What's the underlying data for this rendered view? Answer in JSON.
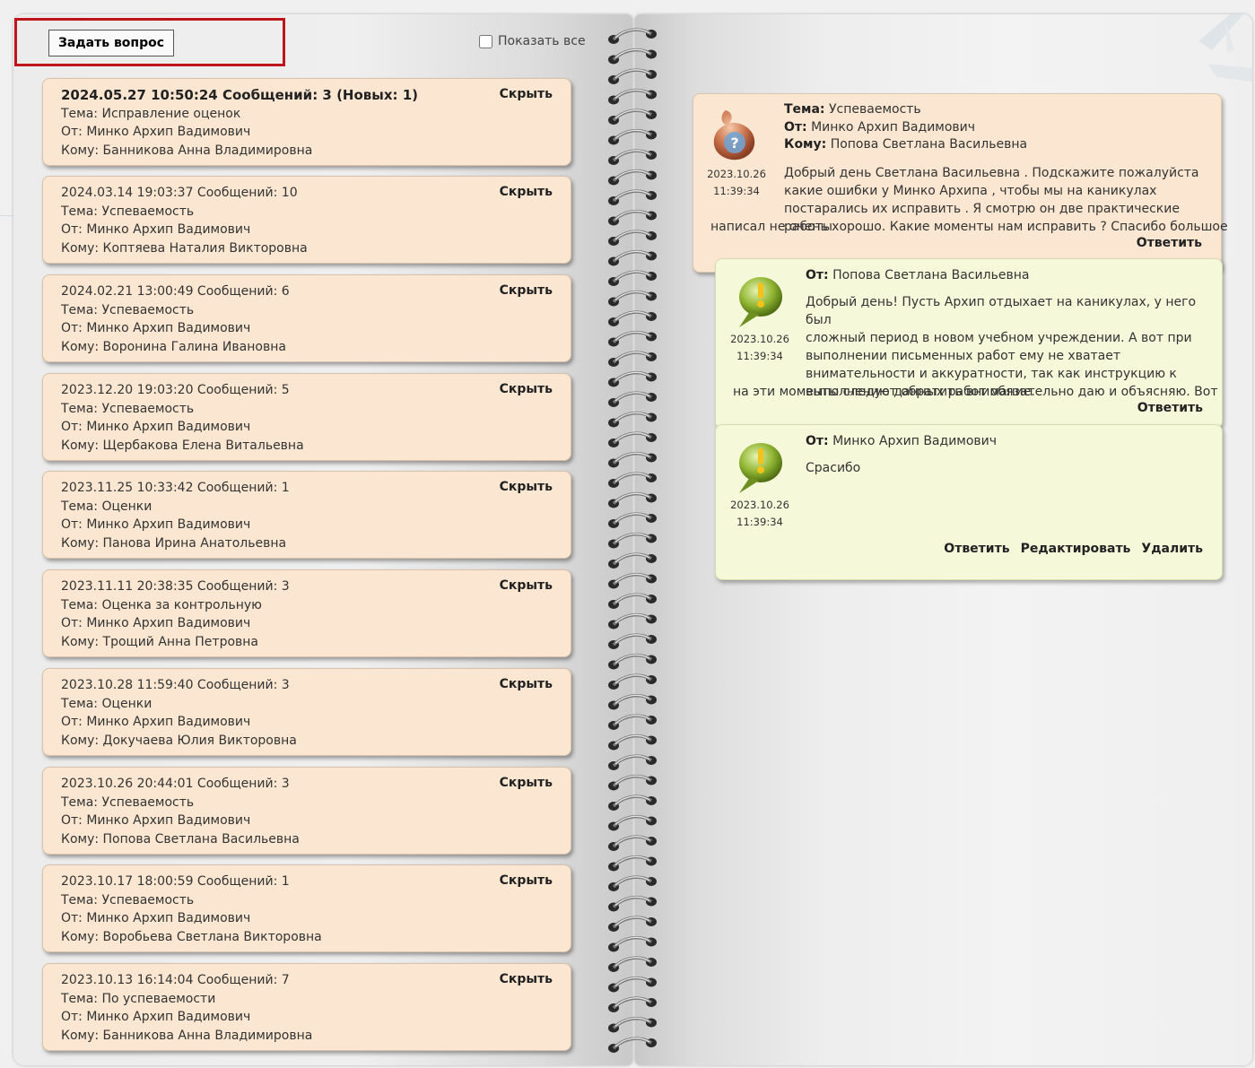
{
  "toolbar": {
    "ask_label": "Задать вопрос",
    "show_all_label": "Показать все",
    "show_all_checked": false
  },
  "threads": [
    {
      "header": "2024.05.27 10:50:24 Сообщений: 3 (Новых: 1)",
      "subject": "Тема: Исправление оценок",
      "from": "От: Минко Архип Вадимович",
      "to": "Кому: Банникова Анна Владимировна",
      "hide": "Скрыть"
    },
    {
      "header": "2024.03.14 19:03:37 Сообщений: 10",
      "subject": "Тема: Успеваемость",
      "from": "От: Минко Архип Вадимович",
      "to": "Кому: Коптяева Наталия Викторовна",
      "hide": "Скрыть"
    },
    {
      "header": "2024.02.21 13:00:49 Сообщений: 6",
      "subject": "Тема: Успеваемость",
      "from": "От: Минко Архип Вадимович",
      "to": "Кому: Воронина Галина Ивановна",
      "hide": "Скрыть"
    },
    {
      "header": "2023.12.20 19:03:20 Сообщений: 5",
      "subject": "Тема: Успеваемость",
      "from": "От: Минко Архип Вадимович",
      "to": "Кому: Щербакова Елена Витальевна",
      "hide": "Скрыть"
    },
    {
      "header": "2023.11.25 10:33:42 Сообщений: 1",
      "subject": "Тема: Оценки",
      "from": "От: Минко Архип Вадимович",
      "to": "Кому: Панова Ирина Анатольевна",
      "hide": "Скрыть"
    },
    {
      "header": "2023.11.11 20:38:35 Сообщений: 3",
      "subject": "Тема: Оценка за контрольную",
      "from": "От: Минко Архип Вадимович",
      "to": "Кому: Трощий Анна Петровна",
      "hide": "Скрыть"
    },
    {
      "header": "2023.10.28 11:59:40 Сообщений: 3",
      "subject": "Тема: Оценки",
      "from": "От: Минко Архип Вадимович",
      "to": "Кому: Докучаева Юлия Викторовна",
      "hide": "Скрыть"
    },
    {
      "header": "2023.10.26 20:44:01 Сообщений: 3",
      "subject": "Тема: Успеваемость",
      "from": "От: Минко Архип Вадимович",
      "to": "Кому: Попова Светлана Васильевна",
      "hide": "Скрыть"
    },
    {
      "header": "2023.10.17 18:00:59 Сообщений: 1",
      "subject": "Тема: Успеваемость",
      "from": "От: Минко Архип Вадимович",
      "to": "Кому: Воробьева Светлана Викторовна",
      "hide": "Скрыть"
    },
    {
      "header": "2023.10.13 16:14:04 Сообщений: 7",
      "subject": "Тема: По успеваемости",
      "from": "От: Минко Архип Вадимович",
      "to": "Кому: Банникова Анна Владимировна",
      "hide": "Скрыть"
    }
  ],
  "conversation": {
    "question": {
      "topic_label": "Тема:",
      "topic": "Успеваемость",
      "from_label": "От:",
      "from": "Минко Архип Вадимович",
      "to_label": "Кому:",
      "to": "Попова Светлана Васильевна",
      "date": "2023.10.26",
      "time": "11:39:34",
      "text_l1": "Добрый день Светлана Васильевна . Подскажите пожалуйста",
      "text_l2": "какие ошибки у Минко Архипа , чтобы мы на каникулах",
      "text_l3": "постарались их исправить . Я смотрю он две практические работы",
      "text_l4": "написал не очень хорошо. Какие моменты нам исправить ? Спасибо большое",
      "reply": "Ответить",
      "avatar_icon": "question-bubble-icon"
    },
    "answer1": {
      "from_label": "От:",
      "from": "Попова Светлана Васильевна",
      "date": "2023.10.26",
      "time": "11:39:34",
      "text_l1": "Добрый день! Пусть Архип отдыхает на каникулах, у него был",
      "text_l2": "сложный период в новом учебном учреждении. А вот при",
      "text_l3": "выполнении письменных работ ему не хватает",
      "text_l4": "внимательности и аккуратности, так как инструкцию к",
      "text_l5": "выполнению данных работ обязательно даю и объясняю. Вот",
      "text_l6": "на эти моменты следует обратить внимание.",
      "reply": "Ответить",
      "avatar_icon": "exclamation-bubble-icon"
    },
    "answer2": {
      "from_label": "От:",
      "from": "Минко Архип Вадимович",
      "date": "2023.10.26",
      "time": "11:39:34",
      "text": "Срасибо",
      "reply": "Ответить",
      "edit": "Редактировать",
      "delete": "Удалить",
      "avatar_icon": "exclamation-bubble-icon"
    }
  },
  "colors": {
    "thread_card": "#fbe7d1",
    "answer_card": "#f5f8d9",
    "highlight": "#c0141c"
  }
}
